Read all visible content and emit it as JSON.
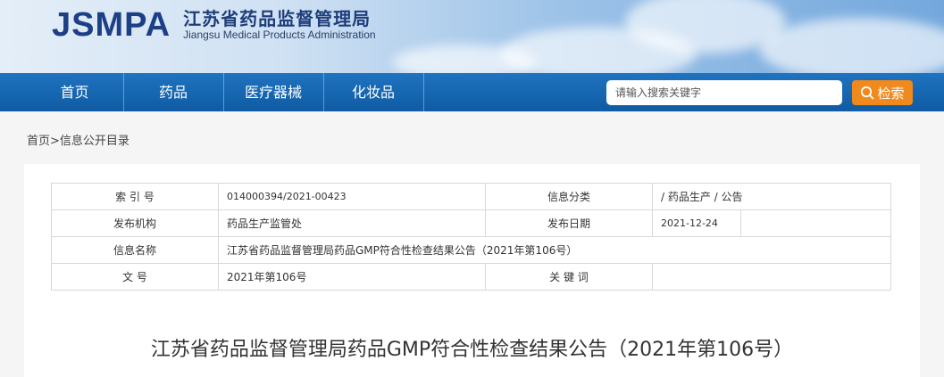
{
  "header": {
    "logo_mark": "JSMPA",
    "org_name_cn": "江苏省药品监督管理局",
    "org_name_en": "Jiangsu Medical Products Administration"
  },
  "nav": {
    "items": [
      {
        "label": "首页"
      },
      {
        "label": "药品"
      },
      {
        "label": "医疗器械"
      },
      {
        "label": "化妆品"
      }
    ],
    "search_placeholder": "请输入搜索关键字",
    "search_button": "检索"
  },
  "breadcrumb": {
    "home": "首页",
    "separator": ">",
    "current": "信息公开目录"
  },
  "meta_table": {
    "rows": [
      {
        "label1": "索 引 号",
        "value1": "014000394/2021-00423",
        "label2": "信息分类",
        "value2": "/ 药品生产 / 公告"
      },
      {
        "label1": "发布机构",
        "value1": "药品生产监管处",
        "label2": "发布日期",
        "value2": "2021-12-24"
      },
      {
        "label1": "信息名称",
        "value1": "江苏省药品监督管理局药品GMP符合性检查结果公告（2021年第106号）"
      },
      {
        "label1": "文 号",
        "value1": "2021年第106号",
        "label2": "关 键 词",
        "value2": ""
      }
    ]
  },
  "document": {
    "title": "江苏省药品监督管理局药品GMP符合性检查结果公告（2021年第106号）"
  },
  "colors": {
    "nav_blue": "#1667b2",
    "search_orange": "#f18a1c",
    "logo_blue": "#1c3f86"
  }
}
